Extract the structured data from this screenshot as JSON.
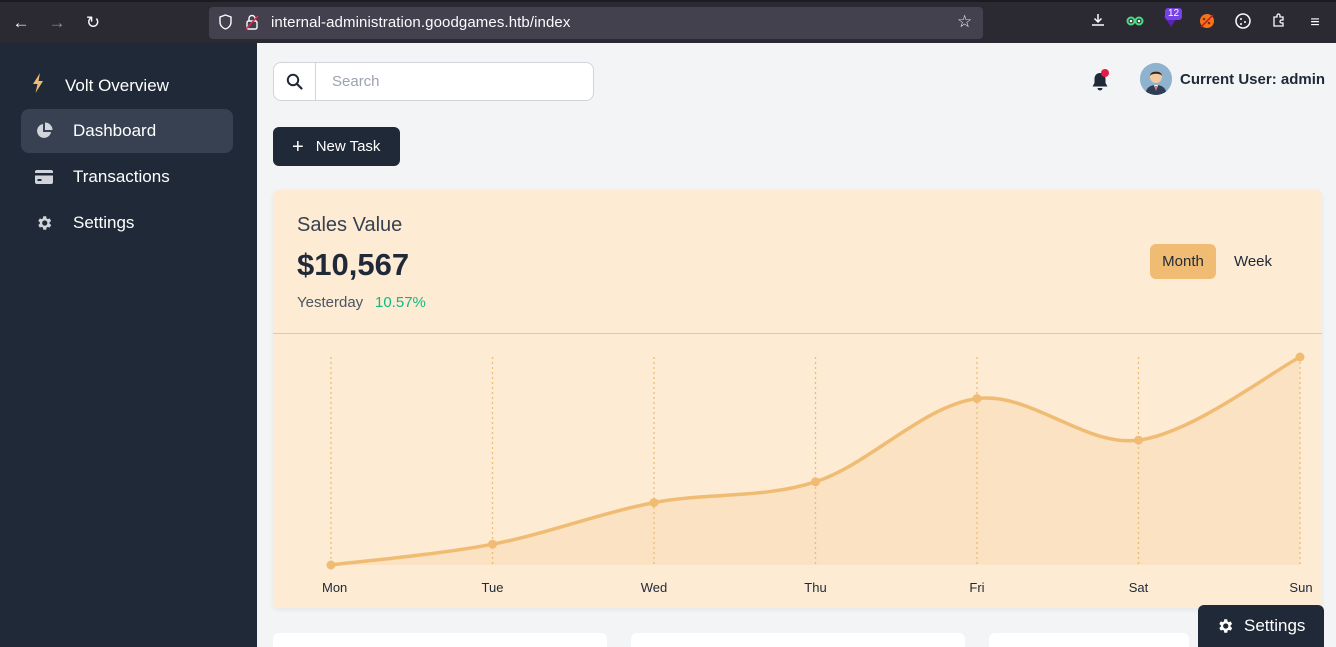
{
  "browser": {
    "url": "internal-administration.goodgames.htb/index",
    "extension_badge": "12"
  },
  "sidebar": {
    "brand": "Volt Overview",
    "items": [
      {
        "label": "Dashboard",
        "icon": "pie-chart-icon",
        "active": true
      },
      {
        "label": "Transactions",
        "icon": "credit-card-icon",
        "active": false
      },
      {
        "label": "Settings",
        "icon": "gear-icon",
        "active": false
      }
    ]
  },
  "topbar": {
    "search_placeholder": "Search",
    "user_label": "Current User: admin"
  },
  "actions": {
    "new_task": "New Task"
  },
  "sales": {
    "title": "Sales Value",
    "value": "$10,567",
    "period": "Yesterday",
    "change": "10.57%",
    "toggle_month": "Month",
    "toggle_week": "Week"
  },
  "chart_data": {
    "type": "line",
    "categories": [
      "Mon",
      "Tue",
      "Wed",
      "Thu",
      "Fri",
      "Sat",
      "Sun"
    ],
    "series": [
      {
        "values": [
          0,
          10,
          30,
          40,
          80,
          60,
          100
        ]
      }
    ],
    "ylim": [
      0,
      100
    ],
    "grid": "vertical dotted lines per category",
    "color": "#f0bc74"
  },
  "floating": {
    "settings_label": "Settings"
  },
  "colors": {
    "sidebar_bg": "#1f2937",
    "accent": "#f0bc74",
    "positive": "#10b981",
    "card_bg": "#fdebd3"
  }
}
